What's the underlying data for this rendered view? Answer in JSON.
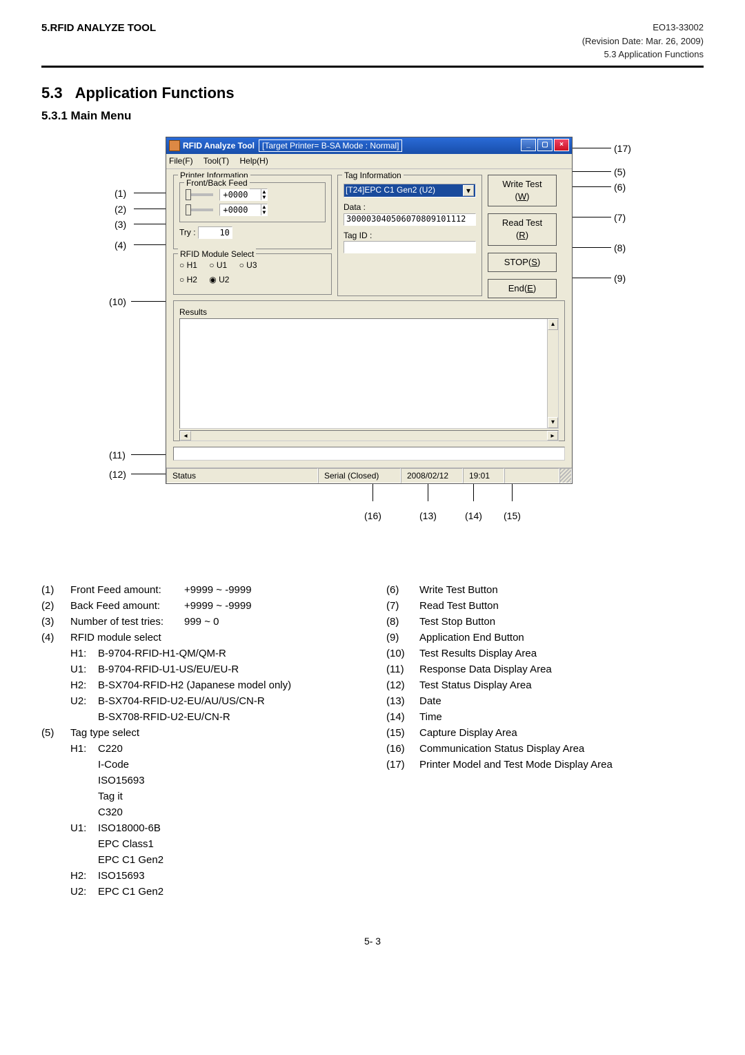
{
  "header": {
    "left": "5.RFID ANALYZE TOOL",
    "right": {
      "code": "EO13-33002",
      "rev": "(Revision Date: Mar. 26, 2009)",
      "sub": "5.3 Application Functions"
    }
  },
  "section": {
    "num": "5.3",
    "title": "Application Functions"
  },
  "subsection": "5.3.1  Main Menu",
  "window": {
    "app_name": "RFID Analyze Tool",
    "title_box": "[Target Printer= B-SA      Mode : Normal]",
    "menu": {
      "file": "File(F)",
      "tool": "Tool(T)",
      "help": "Help(H)"
    },
    "printer_info": {
      "legend": "Printer Information",
      "feed_legend": "Front/Back Feed",
      "front_val": "+0000",
      "back_val": "+0000",
      "try_label": "Try :",
      "try_val": "10"
    },
    "rfid_select": {
      "legend": "RFID Module Select",
      "options": [
        "H1",
        "U1",
        "U3",
        "H2",
        "U2"
      ],
      "selected": "U2"
    },
    "tag_info": {
      "legend": "Tag Information",
      "dropdown_text": "[T24]EPC C1 Gen2 (U2)",
      "data_label": "Data :",
      "data_val": "300003040506070809101112",
      "tagid_label": "Tag ID :"
    },
    "buttons": {
      "write": "Write Test (W)",
      "read": "Read Test (R)",
      "stop": "STOP(S)",
      "end": "End(E)"
    },
    "results_legend": "Results",
    "status": {
      "label": "Status",
      "serial": "Serial (Closed)",
      "date": "2008/02/12",
      "time": "19:01"
    }
  },
  "callouts": {
    "c1": "(1)",
    "c2": "(2)",
    "c3": "(3)",
    "c4": "(4)",
    "c5": "(5)",
    "c6": "(6)",
    "c7": "(7)",
    "c8": "(8)",
    "c9": "(9)",
    "c10": "(10)",
    "c11": "(11)",
    "c12": "(12)",
    "c13": "(13)",
    "c14": "(14)",
    "c15": "(15)",
    "c16": "(16)",
    "c17": "(17)"
  },
  "legend_left": [
    {
      "num": "(1)",
      "label": "Front Feed amount:",
      "val": "+9999 ~ -9999"
    },
    {
      "num": "(2)",
      "label": "Back Feed amount:",
      "val": "+9999 ~ -9999"
    },
    {
      "num": "(3)",
      "label": "Number of test tries:",
      "val": "999 ~ 0"
    },
    {
      "num": "(4)",
      "label": "RFID module select",
      "val": ""
    }
  ],
  "legend_left_4_subs": [
    {
      "key": "H1:",
      "val": "B-9704-RFID-H1-QM/QM-R"
    },
    {
      "key": "U1:",
      "val": "B-9704-RFID-U1-US/EU/EU-R"
    },
    {
      "key": "H2:",
      "val": "B-SX704-RFID-H2 (Japanese model only)"
    },
    {
      "key": "U2:",
      "val": "B-SX704-RFID-U2-EU/AU/US/CN-R"
    },
    {
      "key": "",
      "val": "B-SX708-RFID-U2-EU/CN-R"
    }
  ],
  "legend_left_5_header": {
    "num": "(5)",
    "label": "Tag type select",
    "val": ""
  },
  "legend_left_5_subs": [
    {
      "key": "H1:",
      "vals": [
        "C220",
        "I-Code",
        "ISO15693",
        "Tag it",
        "C320"
      ]
    },
    {
      "key": "U1:",
      "vals": [
        "ISO18000-6B",
        "EPC Class1",
        "EPC C1 Gen2"
      ]
    },
    {
      "key": "H2:",
      "vals": [
        "ISO15693"
      ]
    },
    {
      "key": "U2:",
      "vals": [
        "EPC C1 Gen2"
      ]
    }
  ],
  "legend_right": [
    {
      "num": "(6)",
      "label": "Write Test Button"
    },
    {
      "num": "(7)",
      "label": "Read Test Button"
    },
    {
      "num": "(8)",
      "label": "Test Stop Button"
    },
    {
      "num": "(9)",
      "label": "Application End Button"
    },
    {
      "num": "(10)",
      "label": "Test Results Display Area"
    },
    {
      "num": "(11)",
      "label": "Response Data Display Area"
    },
    {
      "num": "(12)",
      "label": "Test Status Display Area"
    },
    {
      "num": "(13)",
      "label": "Date"
    },
    {
      "num": "(14)",
      "label": "Time"
    },
    {
      "num": "(15)",
      "label": "Capture Display Area"
    },
    {
      "num": "(16)",
      "label": "Communication Status Display Area"
    },
    {
      "num": "(17)",
      "label": "Printer Model and Test Mode Display Area"
    }
  ],
  "page_num": "5- 3"
}
